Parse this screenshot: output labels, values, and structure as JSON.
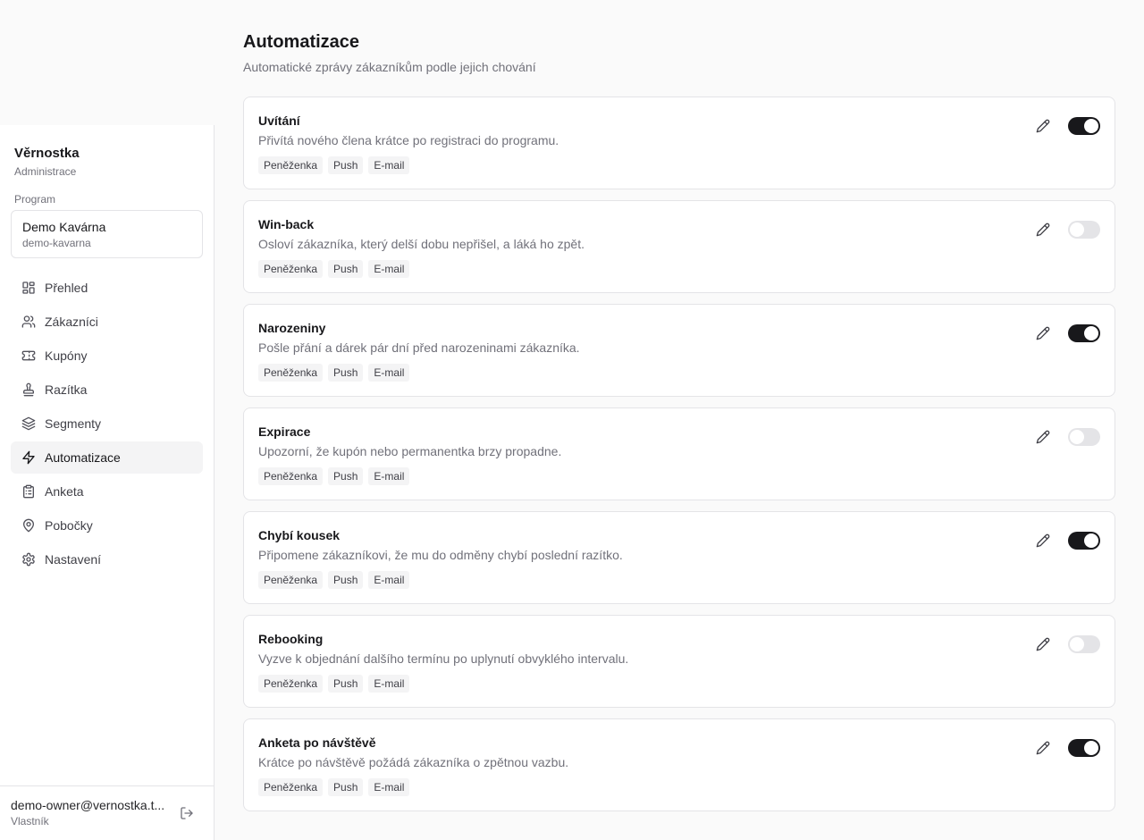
{
  "sidebar": {
    "brand": {
      "name": "Věrnostka",
      "subtitle": "Administrace"
    },
    "program": {
      "label": "Program",
      "name": "Demo Kavárna",
      "slug": "demo-kavarna"
    },
    "nav": [
      {
        "label": "Přehled",
        "icon": "dashboard-icon",
        "active": false
      },
      {
        "label": "Zákazníci",
        "icon": "users-icon",
        "active": false
      },
      {
        "label": "Kupóny",
        "icon": "ticket-icon",
        "active": false
      },
      {
        "label": "Razítka",
        "icon": "stamp-icon",
        "active": false
      },
      {
        "label": "Segmenty",
        "icon": "layers-icon",
        "active": false
      },
      {
        "label": "Automatizace",
        "icon": "zap-icon",
        "active": true
      },
      {
        "label": "Anketa",
        "icon": "clipboard-icon",
        "active": false
      },
      {
        "label": "Pobočky",
        "icon": "map-pin-icon",
        "active": false
      },
      {
        "label": "Nastavení",
        "icon": "gear-icon",
        "active": false
      }
    ],
    "user": {
      "email": "demo-owner@vernostka.t...",
      "role": "Vlastník"
    }
  },
  "main": {
    "title": "Automatizace",
    "subtitle": "Automatické zprávy zákazníkům podle jejich chování",
    "automations": [
      {
        "title": "Uvítání",
        "description": "Přivítá nového člena krátce po registraci do programu.",
        "tags": [
          "Peněženka",
          "Push",
          "E-mail"
        ],
        "enabled": true
      },
      {
        "title": "Win-back",
        "description": "Osloví zákazníka, který delší dobu nepřišel, a láká ho zpět.",
        "tags": [
          "Peněženka",
          "Push",
          "E-mail"
        ],
        "enabled": false
      },
      {
        "title": "Narozeniny",
        "description": "Pošle přání a dárek pár dní před narozeninami zákazníka.",
        "tags": [
          "Peněženka",
          "Push",
          "E-mail"
        ],
        "enabled": true
      },
      {
        "title": "Expirace",
        "description": "Upozorní, že kupón nebo permanentka brzy propadne.",
        "tags": [
          "Peněženka",
          "Push",
          "E-mail"
        ],
        "enabled": false
      },
      {
        "title": "Chybí kousek",
        "description": "Připomene zákazníkovi, že mu do odměny chybí poslední razítko.",
        "tags": [
          "Peněženka",
          "Push",
          "E-mail"
        ],
        "enabled": true
      },
      {
        "title": "Rebooking",
        "description": "Vyzve k objednání dalšího termínu po uplynutí obvyklého intervalu.",
        "tags": [
          "Peněženka",
          "Push",
          "E-mail"
        ],
        "enabled": false
      },
      {
        "title": "Anketa po návštěvě",
        "description": "Krátce po návštěvě požádá zákazníka o zpětnou vazbu.",
        "tags": [
          "Peněženka",
          "Push",
          "E-mail"
        ],
        "enabled": true
      }
    ]
  },
  "colors": {
    "accent": "#18181b",
    "muted": "#71717a",
    "border": "#e4e4e7",
    "tag_bg": "#f4f4f5",
    "toggle_off": "#e4e4e7"
  }
}
